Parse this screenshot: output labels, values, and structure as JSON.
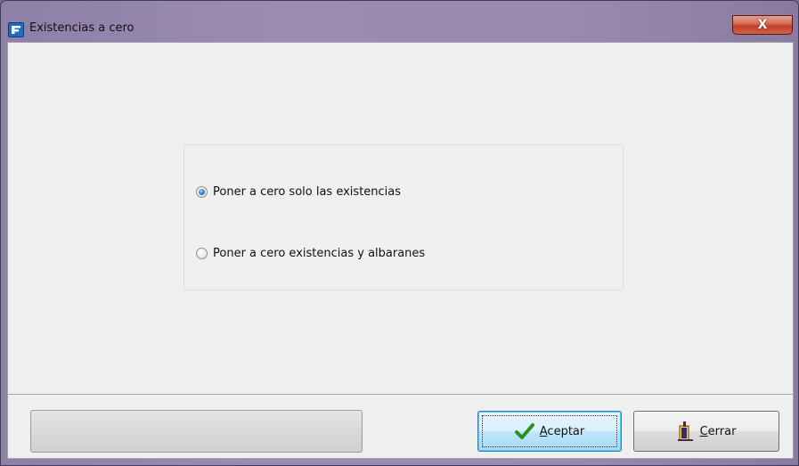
{
  "window": {
    "title": "Existencias a cero",
    "close_label": "X"
  },
  "options": {
    "items": [
      {
        "label": "Poner a cero solo las existencias",
        "checked": true
      },
      {
        "label": "Poner a cero existencias y albaranes",
        "checked": false
      }
    ]
  },
  "status": {
    "text": ""
  },
  "buttons": {
    "accept": {
      "mnemonic": "A",
      "rest": "ceptar",
      "icon": "checkmark-icon"
    },
    "close": {
      "mnemonic": "C",
      "rest": "errar",
      "icon": "exit-door-icon"
    }
  },
  "colors": {
    "title_gradient": "#9c8db0",
    "close_button": "#c2402a",
    "client_background": "#efefef",
    "radio_checked": "#2a7bcf",
    "accept_check": "#2f8f1e"
  }
}
